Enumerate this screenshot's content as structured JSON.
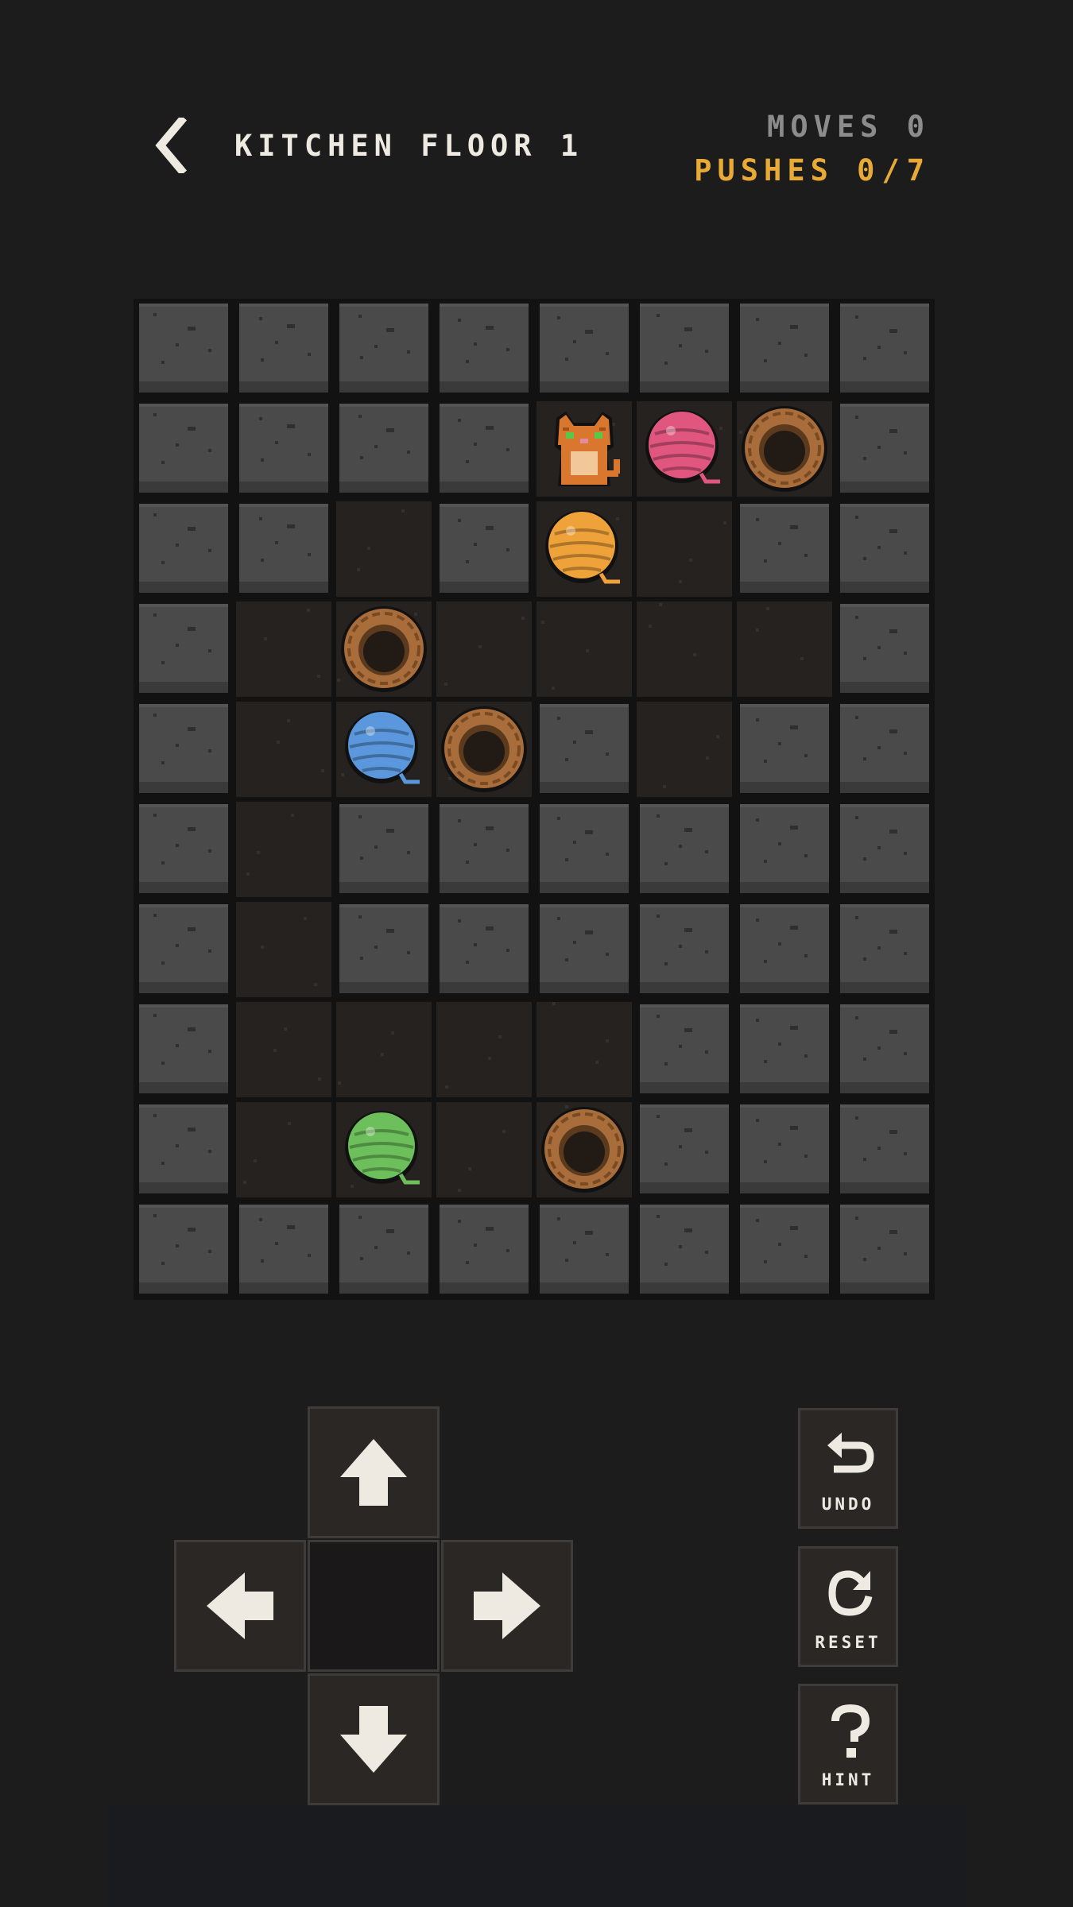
{
  "header": {
    "level_title": "KITCHEN FLOOR 1",
    "moves_label": "MOVES",
    "moves_value": "0",
    "pushes_label": "PUSHES",
    "pushes_value": "0",
    "pushes_total": "7",
    "pushes_sep": "/"
  },
  "board": {
    "cols": 8,
    "rows": 10,
    "layout": [
      "########",
      "####@Bo#",
      "##.#Y.##",
      "#.o....#",
      "#.bo#.##",
      "#.######",
      "#.######",
      "#....###",
      "#.g.o###",
      "########"
    ],
    "legend": {
      "#": "wall",
      ".": "floor",
      "@": "cat",
      "o": "basket",
      "B": "yarn-pink",
      "Y": "yarn-orange",
      "b": "yarn-blue",
      "g": "yarn-green"
    }
  },
  "colors": {
    "pushes_accent": "#e9a935",
    "yarn_pink": "#e0567f",
    "yarn_orange": "#f0a23a",
    "yarn_blue": "#5a97dc",
    "yarn_green": "#6cbf5a",
    "wall": "#4a4a4a",
    "floor": "#262220"
  },
  "controls": {
    "up_icon": "arrow-up-icon",
    "down_icon": "arrow-down-icon",
    "left_icon": "arrow-left-icon",
    "right_icon": "arrow-right-icon",
    "undo_label": "UNDO",
    "reset_label": "RESET",
    "hint_label": "HINT"
  }
}
